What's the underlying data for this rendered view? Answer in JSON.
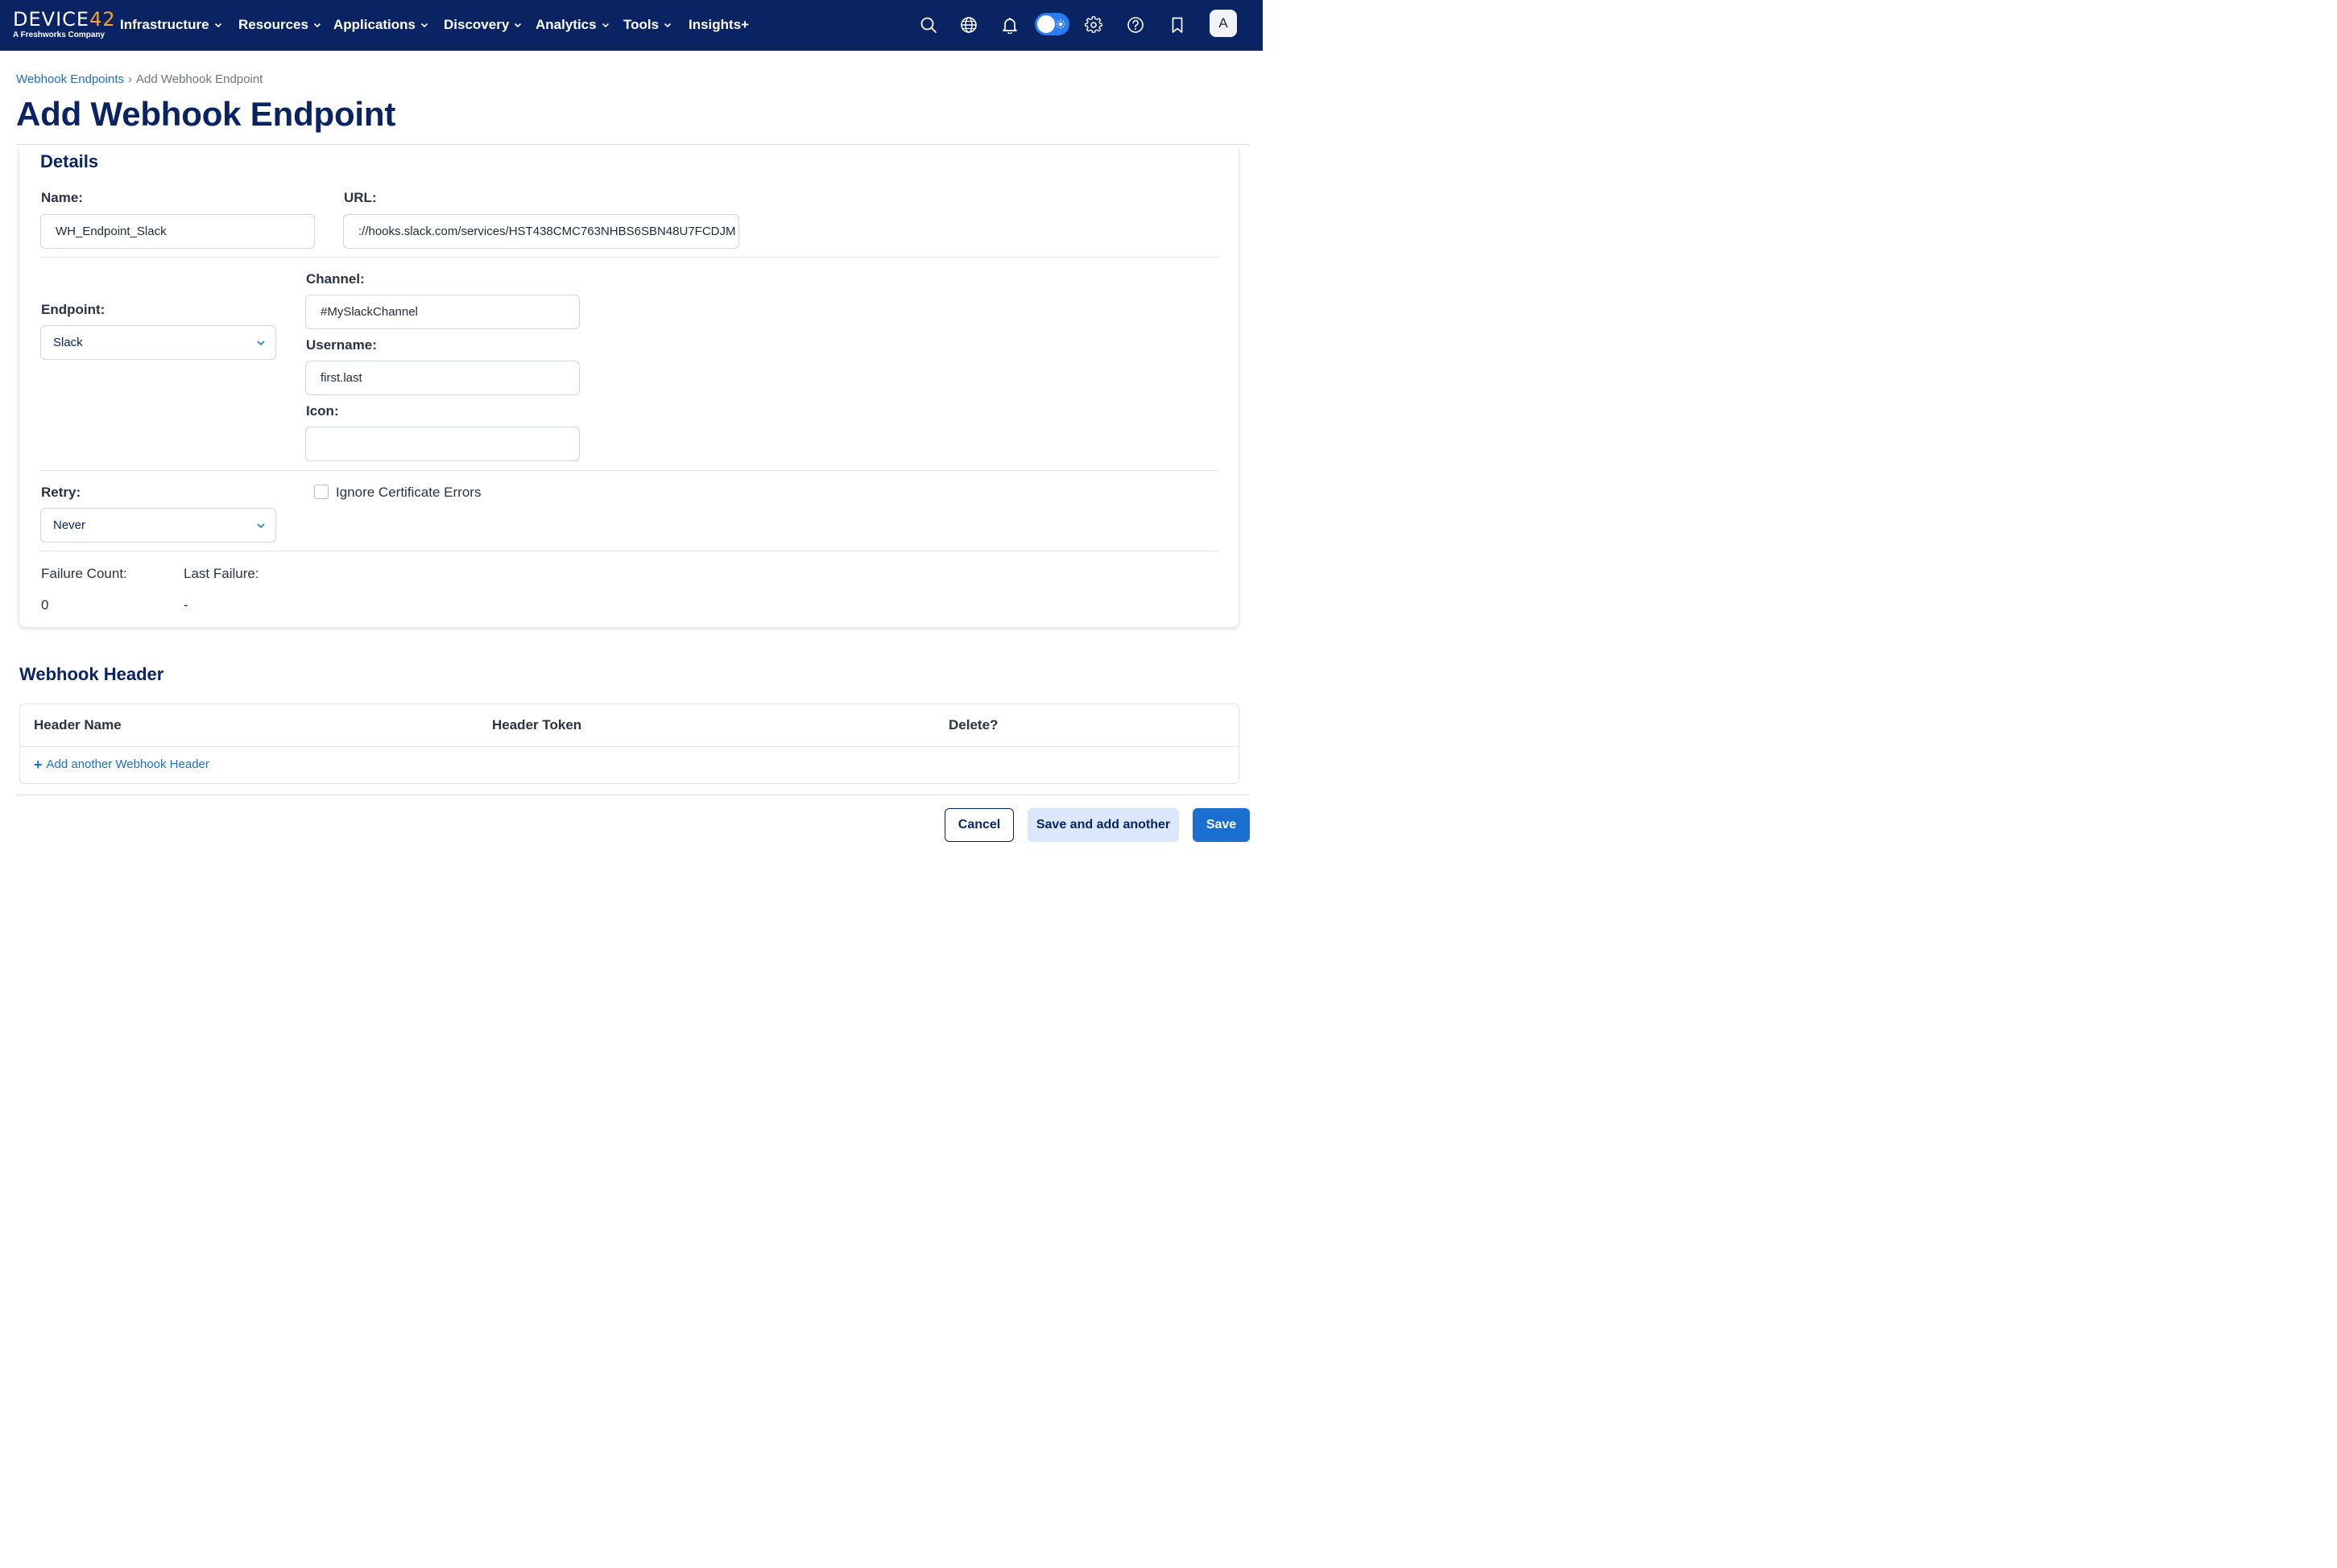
{
  "brand": {
    "logo_text": "DEVICE",
    "logo_accent": "42",
    "tagline": "A Freshworks Company",
    "colors": {
      "nav_bg": "#0a2463",
      "accent": "#f6a623",
      "link": "#1a6fd0",
      "primary": "#1a6fd0"
    }
  },
  "nav": {
    "items": [
      {
        "label": "Infrastructure",
        "has_dropdown": true
      },
      {
        "label": "Resources",
        "has_dropdown": true
      },
      {
        "label": "Applications",
        "has_dropdown": true
      },
      {
        "label": "Discovery",
        "has_dropdown": true
      },
      {
        "label": "Analytics",
        "has_dropdown": true
      },
      {
        "label": "Tools",
        "has_dropdown": true
      },
      {
        "label": "Insights+",
        "has_dropdown": false
      }
    ],
    "icons": [
      "search-icon",
      "globe-icon",
      "bell-icon",
      "theme-toggle",
      "gear-icon",
      "help-icon",
      "bookmark-icon"
    ],
    "avatar_initial": "A"
  },
  "breadcrumb": {
    "parent": "Webhook Endpoints",
    "separator": "›",
    "current": "Add Webhook Endpoint"
  },
  "page": {
    "title": "Add Webhook Endpoint"
  },
  "details": {
    "title": "Details",
    "name": {
      "label": "Name:",
      "value": "WH_Endpoint_Slack"
    },
    "url": {
      "label": "URL:",
      "value": "://hooks.slack.com/services/HST438CMC763NHBS6SBN48U7FCDJM"
    },
    "endpoint": {
      "label": "Endpoint:",
      "value": "Slack"
    },
    "channel": {
      "label": "Channel:",
      "value": "#MySlackChannel"
    },
    "username": {
      "label": "Username:",
      "value": "first.last"
    },
    "icon": {
      "label": "Icon:",
      "value": ""
    },
    "retry": {
      "label": "Retry:",
      "value": "Never"
    },
    "ignore_cert": {
      "label": "Ignore Certificate Errors",
      "checked": false
    },
    "failure_count": {
      "label": "Failure Count:",
      "value": "0"
    },
    "last_failure": {
      "label": "Last Failure:",
      "value": "-"
    }
  },
  "webhook_header": {
    "title": "Webhook Header",
    "columns": [
      "Header Name",
      "Header Token",
      "Delete?"
    ],
    "add_link": "Add another Webhook Header"
  },
  "actions": {
    "cancel": "Cancel",
    "save_and_add": "Save and add another",
    "save": "Save"
  }
}
